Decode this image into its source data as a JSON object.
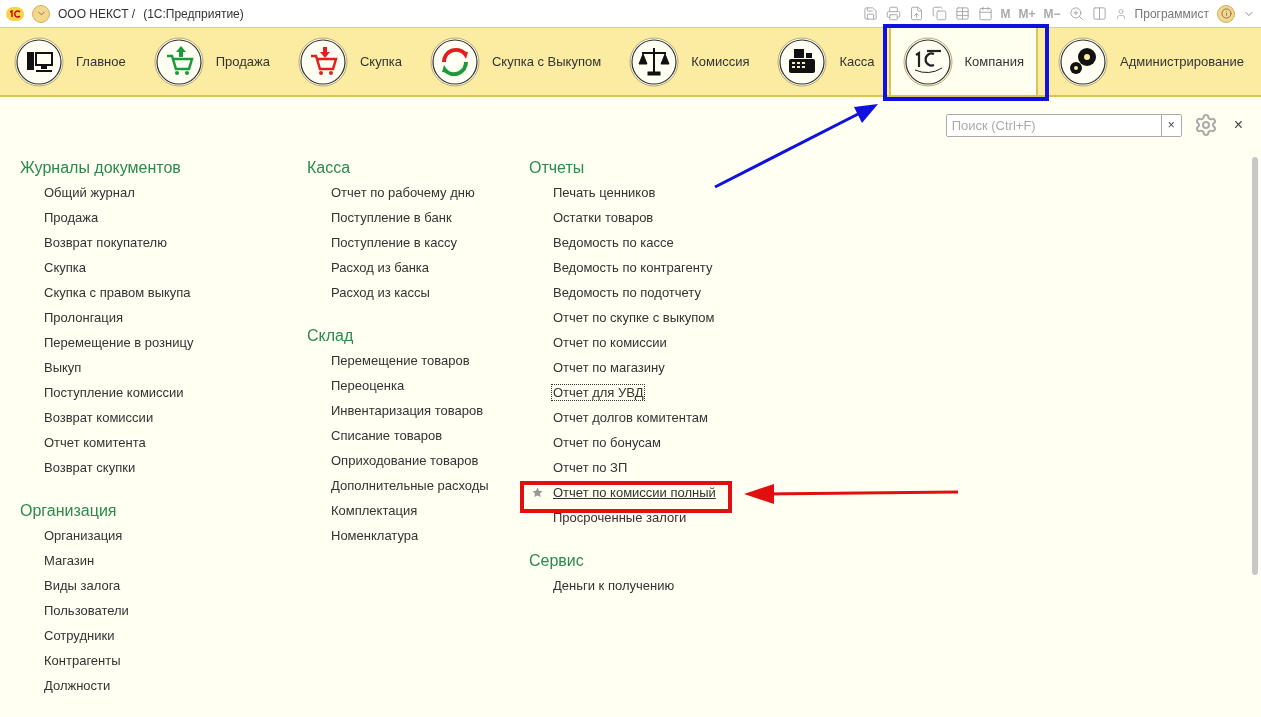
{
  "window": {
    "company": "ООО НЕКСТ /",
    "title": "(1С:Предприятие)",
    "toolbar_letters": [
      "M",
      "M+",
      "M−"
    ],
    "user": "Программист"
  },
  "sections": [
    {
      "label": "Главное",
      "kind": "computer",
      "selected": false
    },
    {
      "label": "Продажа",
      "kind": "sale",
      "selected": false
    },
    {
      "label": "Скупка",
      "kind": "buy",
      "selected": false
    },
    {
      "label": "Скупка с Выкупом",
      "kind": "exchange",
      "selected": false
    },
    {
      "label": "Комиссия",
      "kind": "scales",
      "selected": false
    },
    {
      "label": "Касса",
      "kind": "register",
      "selected": false
    },
    {
      "label": "Компания",
      "kind": "logo",
      "selected": true
    },
    {
      "label": "Администрирование",
      "kind": "gears",
      "selected": false
    }
  ],
  "search": {
    "placeholder": "Поиск (Ctrl+F)",
    "clear": "×"
  },
  "close": "×",
  "columns": [
    [
      {
        "title": "Журналы документов",
        "items": [
          {
            "label": "Общий журнал",
            "favorite": false,
            "focused": false
          },
          {
            "label": "Продажа",
            "favorite": false,
            "focused": false
          },
          {
            "label": "Возврат покупателю",
            "favorite": false,
            "focused": false
          },
          {
            "label": "Скупка",
            "favorite": false,
            "focused": false
          },
          {
            "label": "Скупка с правом выкупа",
            "favorite": false,
            "focused": false
          },
          {
            "label": "Пролонгация",
            "favorite": false,
            "focused": false
          },
          {
            "label": "Перемещение в розницу",
            "favorite": false,
            "focused": false
          },
          {
            "label": "Выкуп",
            "favorite": false,
            "focused": false
          },
          {
            "label": "Поступление комиссии",
            "favorite": false,
            "focused": false
          },
          {
            "label": "Возврат комиссии",
            "favorite": false,
            "focused": false
          },
          {
            "label": "Отчет комитента",
            "favorite": false,
            "focused": false
          },
          {
            "label": "Возврат скупки",
            "favorite": false,
            "focused": false
          }
        ]
      },
      {
        "title": "Организация",
        "items": [
          {
            "label": "Организация",
            "favorite": false,
            "focused": false
          },
          {
            "label": "Магазин",
            "favorite": false,
            "focused": false
          },
          {
            "label": "Виды залога",
            "favorite": false,
            "focused": false
          },
          {
            "label": "Пользователи",
            "favorite": false,
            "focused": false
          },
          {
            "label": "Сотрудники",
            "favorite": false,
            "focused": false
          },
          {
            "label": "Контрагенты",
            "favorite": false,
            "focused": false
          },
          {
            "label": "Должности",
            "favorite": false,
            "focused": false
          }
        ]
      }
    ],
    [
      {
        "title": "Касса",
        "items": [
          {
            "label": "Отчет по рабочему дню",
            "favorite": false,
            "focused": false
          },
          {
            "label": "Поступление в банк",
            "favorite": false,
            "focused": false
          },
          {
            "label": "Поступление в кассу",
            "favorite": false,
            "focused": false
          },
          {
            "label": "Расход из банка",
            "favorite": false,
            "focused": false
          },
          {
            "label": "Расход из кассы",
            "favorite": false,
            "focused": false
          }
        ]
      },
      {
        "title": "Склад",
        "items": [
          {
            "label": "Перемещение товаров",
            "favorite": false,
            "focused": false
          },
          {
            "label": "Переоценка",
            "favorite": false,
            "focused": false
          },
          {
            "label": "Инвентаризация товаров",
            "favorite": false,
            "focused": false
          },
          {
            "label": "Списание товаров",
            "favorite": false,
            "focused": false
          },
          {
            "label": "Оприходование товаров",
            "favorite": false,
            "focused": false
          },
          {
            "label": "Дополнительные расходы",
            "favorite": false,
            "focused": false
          },
          {
            "label": "Комплектация",
            "favorite": false,
            "focused": false
          },
          {
            "label": "Номенклатура",
            "favorite": false,
            "focused": false
          }
        ]
      }
    ],
    [
      {
        "title": "Отчеты",
        "items": [
          {
            "label": "Печать ценников",
            "favorite": false,
            "focused": false
          },
          {
            "label": "Остатки товаров",
            "favorite": false,
            "focused": false
          },
          {
            "label": "Ведомость по кассе",
            "favorite": false,
            "focused": false
          },
          {
            "label": "Ведомость по контрагенту",
            "favorite": false,
            "focused": false
          },
          {
            "label": "Ведомость по подотчету",
            "favorite": false,
            "focused": false
          },
          {
            "label": "Отчет по скупке с выкупом",
            "favorite": false,
            "focused": false
          },
          {
            "label": "Отчет по комиссии",
            "favorite": false,
            "focused": false
          },
          {
            "label": "Отчет по магазину",
            "favorite": false,
            "focused": false
          },
          {
            "label": "Отчет для УВД",
            "favorite": false,
            "focused": true
          },
          {
            "label": "Отчет долгов комитентам",
            "favorite": false,
            "focused": false
          },
          {
            "label": "Отчет по бонусам",
            "favorite": false,
            "focused": false
          },
          {
            "label": "Отчет по ЗП",
            "favorite": false,
            "focused": false
          },
          {
            "label": "Отчет по комиссии полный",
            "favorite": true,
            "focused": false
          },
          {
            "label": "Просроченные залоги",
            "favorite": false,
            "focused": false
          }
        ]
      },
      {
        "title": "Сервис",
        "items": [
          {
            "label": "Деньги к получению",
            "favorite": false,
            "focused": false
          }
        ]
      }
    ]
  ]
}
